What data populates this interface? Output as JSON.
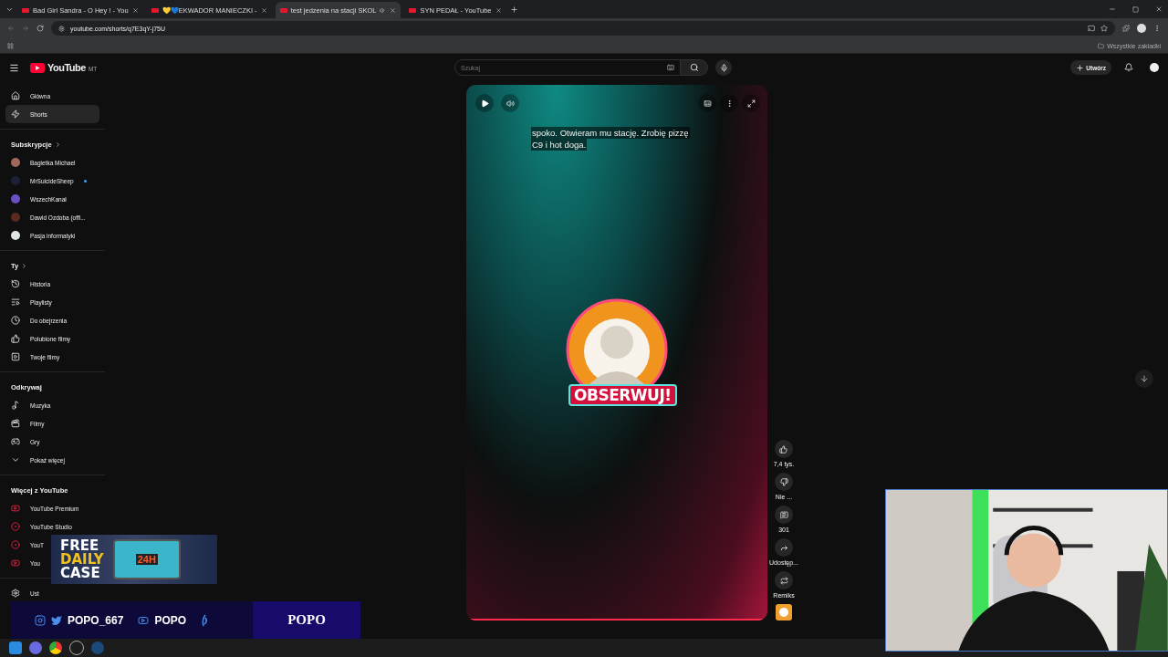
{
  "browser": {
    "tabs": [
      {
        "title": "Bad Girl Sandra - O Hey ! - You",
        "selected": false,
        "audio": false
      },
      {
        "title": "💛💙EKWADOR MANIECZKI -",
        "selected": false,
        "audio": false
      },
      {
        "title": "test jedzenia na stacji SKOL",
        "selected": true,
        "audio": true
      },
      {
        "title": "SYN PEDAŁ - YouTube",
        "selected": false,
        "audio": false
      }
    ],
    "address": "youtube.com/shorts/q7E3qY-j75U",
    "bookmarks_folder": "Wszystkie zakładki"
  },
  "header": {
    "logo": "YouTube",
    "logo_badge": "MT",
    "search_placeholder": "Szukaj",
    "create_label": "Utwórz"
  },
  "sidebar": {
    "sections": [
      {
        "items": [
          {
            "kind": "nav",
            "label": "Główna",
            "selected": false
          },
          {
            "kind": "nav",
            "label": "Shorts",
            "selected": true
          }
        ]
      },
      {
        "heading": "Subskrypcje",
        "items": [
          {
            "kind": "channel",
            "label": "Bagietka Michael",
            "color": "#a0685a",
            "new": false
          },
          {
            "kind": "channel",
            "label": "MrSuicideSheep",
            "color": "#1b2238",
            "new": true
          },
          {
            "kind": "channel",
            "label": "WszechKanał",
            "color": "#6b4fc4",
            "new": false
          },
          {
            "kind": "channel",
            "label": "Dawid Ozdoba (offi...",
            "color": "#5a2a1e",
            "new": false
          },
          {
            "kind": "channel",
            "label": "Pasja informatyki",
            "color": "#dfe6e4",
            "new": false
          }
        ]
      },
      {
        "heading": "Ty",
        "items": [
          {
            "kind": "nav",
            "label": "Historia",
            "selected": false
          },
          {
            "kind": "nav",
            "label": "Playlisty",
            "selected": false
          },
          {
            "kind": "nav",
            "label": "Do obejrzenia",
            "selected": false
          },
          {
            "kind": "nav",
            "label": "Polubione filmy",
            "selected": false
          },
          {
            "kind": "nav",
            "label": "Twoje filmy",
            "selected": false
          }
        ]
      },
      {
        "heading": "Odkrywaj",
        "items": [
          {
            "kind": "nav",
            "label": "Muzyka",
            "selected": false
          },
          {
            "kind": "nav",
            "label": "Filmy",
            "selected": false
          },
          {
            "kind": "nav",
            "label": "Gry",
            "selected": false
          },
          {
            "kind": "nav",
            "label": "Pokaż więcej",
            "selected": false
          }
        ]
      },
      {
        "heading": "Więcej z YouTube",
        "items": [
          {
            "kind": "nav",
            "label": "YouTube Premium",
            "selected": false
          },
          {
            "kind": "nav",
            "label": "YouTube Studio",
            "selected": false
          },
          {
            "kind": "nav",
            "label": "YouT",
            "selected": false
          },
          {
            "kind": "nav",
            "label": "You",
            "selected": false
          }
        ]
      },
      {
        "items": [
          {
            "kind": "nav",
            "label": "Ust",
            "selected": false
          }
        ]
      }
    ]
  },
  "player": {
    "subtitle_lines": [
      "spoko. Otwieram mu stację. Zrobię pizzę",
      "C9 i hot doga."
    ],
    "logo_caption": "OBSERWUJ!",
    "progress": {
      "level": 0.99
    }
  },
  "actions": [
    {
      "label": "7,4 tys."
    },
    {
      "label": "Nie ..."
    },
    {
      "label": "301"
    },
    {
      "label": "Udostęp..."
    },
    {
      "label": "Remiks"
    }
  ],
  "overlay": {
    "ad_lines": [
      "FREE",
      "DAILY",
      "CASE"
    ],
    "ad_badge": "24H",
    "social_handle": "POPO_667",
    "social_channel": "POPO",
    "brand": "POPO"
  }
}
